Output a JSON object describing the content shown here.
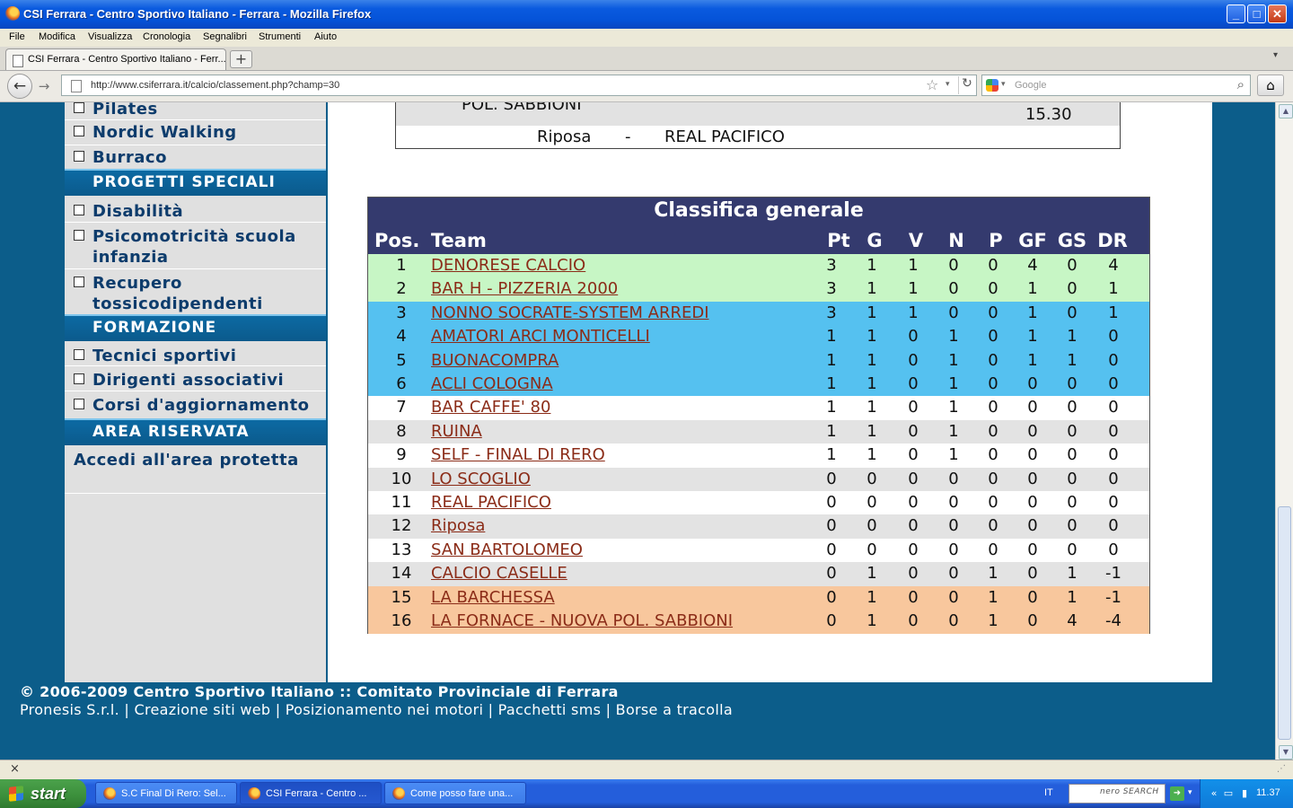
{
  "window": {
    "title": "CSI Ferrara - Centro Sportivo Italiano - Ferrara - Mozilla Firefox"
  },
  "menu": [
    "File",
    "Modifica",
    "Visualizza",
    "Cronologia",
    "Segnalibri",
    "Strumenti",
    "Aiuto"
  ],
  "tab": {
    "title": "CSI Ferrara - Centro Sportivo Italiano - Ferr...",
    "new_tab": "+"
  },
  "address": {
    "url": "http://www.csiferrara.it/calcio/classement.php?champ=30"
  },
  "search": {
    "placeholder": "Google"
  },
  "sidebar": {
    "items_top": [
      "Pilates",
      "Nordic Walking",
      "Burraco"
    ],
    "section1": "PROGETTI SPECIALI",
    "items_s1": [
      "Disabilità",
      "Psicomotricità scuola infanzia",
      "Recupero tossicodipendenti"
    ],
    "section2": "FORMAZIONE",
    "items_s2": [
      "Tecnici sportivi",
      "Dirigenti associativi",
      "Corsi d'aggiornamento"
    ],
    "section3": "AREA RISERVATA",
    "login_link": "Accedi all'area protetta"
  },
  "fixture": {
    "team": "POL. SABBIONI",
    "time": "15.30",
    "rest_label": "Riposa",
    "dash": "-",
    "rest_team": "REAL PACIFICO"
  },
  "standings": {
    "title": "Classifica generale",
    "headers": [
      "Pos.",
      "Team",
      "Pt",
      "G",
      "V",
      "N",
      "P",
      "GF",
      "GS",
      "DR"
    ],
    "rows": [
      {
        "pos": "1",
        "team": "DENORESE CALCIO",
        "pt": "3",
        "g": "1",
        "v": "1",
        "n": "0",
        "p": "0",
        "gf": "4",
        "gs": "0",
        "dr": "4"
      },
      {
        "pos": "2",
        "team": "BAR H - PIZZERIA 2000",
        "pt": "3",
        "g": "1",
        "v": "1",
        "n": "0",
        "p": "0",
        "gf": "1",
        "gs": "0",
        "dr": "1"
      },
      {
        "pos": "3",
        "team": "NONNO SOCRATE-SYSTEM ARREDI",
        "pt": "3",
        "g": "1",
        "v": "1",
        "n": "0",
        "p": "0",
        "gf": "1",
        "gs": "0",
        "dr": "1"
      },
      {
        "pos": "4",
        "team": "AMATORI ARCI MONTICELLI",
        "pt": "1",
        "g": "1",
        "v": "0",
        "n": "1",
        "p": "0",
        "gf": "1",
        "gs": "1",
        "dr": "0"
      },
      {
        "pos": "5",
        "team": "BUONACOMPRA",
        "pt": "1",
        "g": "1",
        "v": "0",
        "n": "1",
        "p": "0",
        "gf": "1",
        "gs": "1",
        "dr": "0"
      },
      {
        "pos": "6",
        "team": "ACLI COLOGNA",
        "pt": "1",
        "g": "1",
        "v": "0",
        "n": "1",
        "p": "0",
        "gf": "0",
        "gs": "0",
        "dr": "0"
      },
      {
        "pos": "7",
        "team": "BAR CAFFE' 80",
        "pt": "1",
        "g": "1",
        "v": "0",
        "n": "1",
        "p": "0",
        "gf": "0",
        "gs": "0",
        "dr": "0"
      },
      {
        "pos": "8",
        "team": "RUINA",
        "pt": "1",
        "g": "1",
        "v": "0",
        "n": "1",
        "p": "0",
        "gf": "0",
        "gs": "0",
        "dr": "0"
      },
      {
        "pos": "9",
        "team": "SELF - FINAL DI RERO",
        "pt": "1",
        "g": "1",
        "v": "0",
        "n": "1",
        "p": "0",
        "gf": "0",
        "gs": "0",
        "dr": "0"
      },
      {
        "pos": "10",
        "team": "LO SCOGLIO",
        "pt": "0",
        "g": "0",
        "v": "0",
        "n": "0",
        "p": "0",
        "gf": "0",
        "gs": "0",
        "dr": "0"
      },
      {
        "pos": "11",
        "team": "REAL PACIFICO",
        "pt": "0",
        "g": "0",
        "v": "0",
        "n": "0",
        "p": "0",
        "gf": "0",
        "gs": "0",
        "dr": "0"
      },
      {
        "pos": "12",
        "team": "Riposa",
        "pt": "0",
        "g": "0",
        "v": "0",
        "n": "0",
        "p": "0",
        "gf": "0",
        "gs": "0",
        "dr": "0"
      },
      {
        "pos": "13",
        "team": "SAN BARTOLOMEO",
        "pt": "0",
        "g": "0",
        "v": "0",
        "n": "0",
        "p": "0",
        "gf": "0",
        "gs": "0",
        "dr": "0"
      },
      {
        "pos": "14",
        "team": "CALCIO CASELLE",
        "pt": "0",
        "g": "1",
        "v": "0",
        "n": "0",
        "p": "1",
        "gf": "0",
        "gs": "1",
        "dr": "-1"
      },
      {
        "pos": "15",
        "team": "LA BARCHESSA",
        "pt": "0",
        "g": "1",
        "v": "0",
        "n": "0",
        "p": "1",
        "gf": "0",
        "gs": "1",
        "dr": "-1"
      },
      {
        "pos": "16",
        "team": "LA FORNACE - NUOVA POL. SABBIONI",
        "pt": "0",
        "g": "1",
        "v": "0",
        "n": "0",
        "p": "1",
        "gf": "0",
        "gs": "4",
        "dr": "-4"
      }
    ],
    "row_colors": [
      "#c7f6c5",
      "#c7f6c5",
      "#55c1f0",
      "#55c1f0",
      "#55c1f0",
      "#55c1f0",
      "#ffffff",
      "#e3e3e3",
      "#ffffff",
      "#e3e3e3",
      "#ffffff",
      "#e3e3e3",
      "#ffffff",
      "#e3e3e3",
      "#f8c79d",
      "#f8c79d"
    ]
  },
  "footer": {
    "copyright": "© 2006-2009 Centro Sportivo Italiano :: Comitato Provinciale di Ferrara",
    "links": "Pronesis S.r.l. | Creazione siti web | Posizionamento nei motori | Pacchetti sms | Borse a tracolla"
  },
  "taskbar": {
    "start": "start",
    "tasks": [
      "S.C Final Di Rero: Sel...",
      "CSI Ferrara - Centro ...",
      "Come posso fare una..."
    ],
    "lang": "IT",
    "nero": "nero SEARCH",
    "clock": "11.37"
  },
  "status": {
    "close": "×"
  }
}
